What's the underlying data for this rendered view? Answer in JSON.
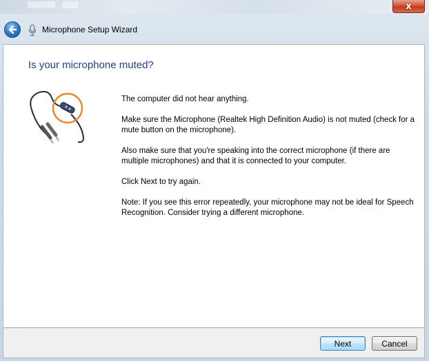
{
  "window": {
    "title": "Microphone Setup Wizard",
    "close_glyph": "x"
  },
  "icons": {
    "back": "back-arrow-icon",
    "app": "microphone-icon",
    "close": "close-icon",
    "illustration": "headset-microphone-cable-icon"
  },
  "page": {
    "heading": "Is your microphone muted?",
    "paragraphs": [
      "The computer did not hear anything.",
      "Make sure the Microphone (Realtek High Definition Audio) is not muted (check for a mute button on the microphone).",
      " Also make sure that you're speaking into the correct microphone (if there are multiple microphones) and that it is connected to your computer.",
      "Click Next to try again.",
      "Note: If you see this error repeatedly, your microphone may not be ideal for Speech Recognition. Consider trying a different microphone."
    ]
  },
  "footer": {
    "next_label": "Next",
    "cancel_label": "Cancel"
  },
  "colors": {
    "heading": "#1e3f8a",
    "highlight_ring": "#e8892b",
    "close_button": "#c23a1e"
  }
}
